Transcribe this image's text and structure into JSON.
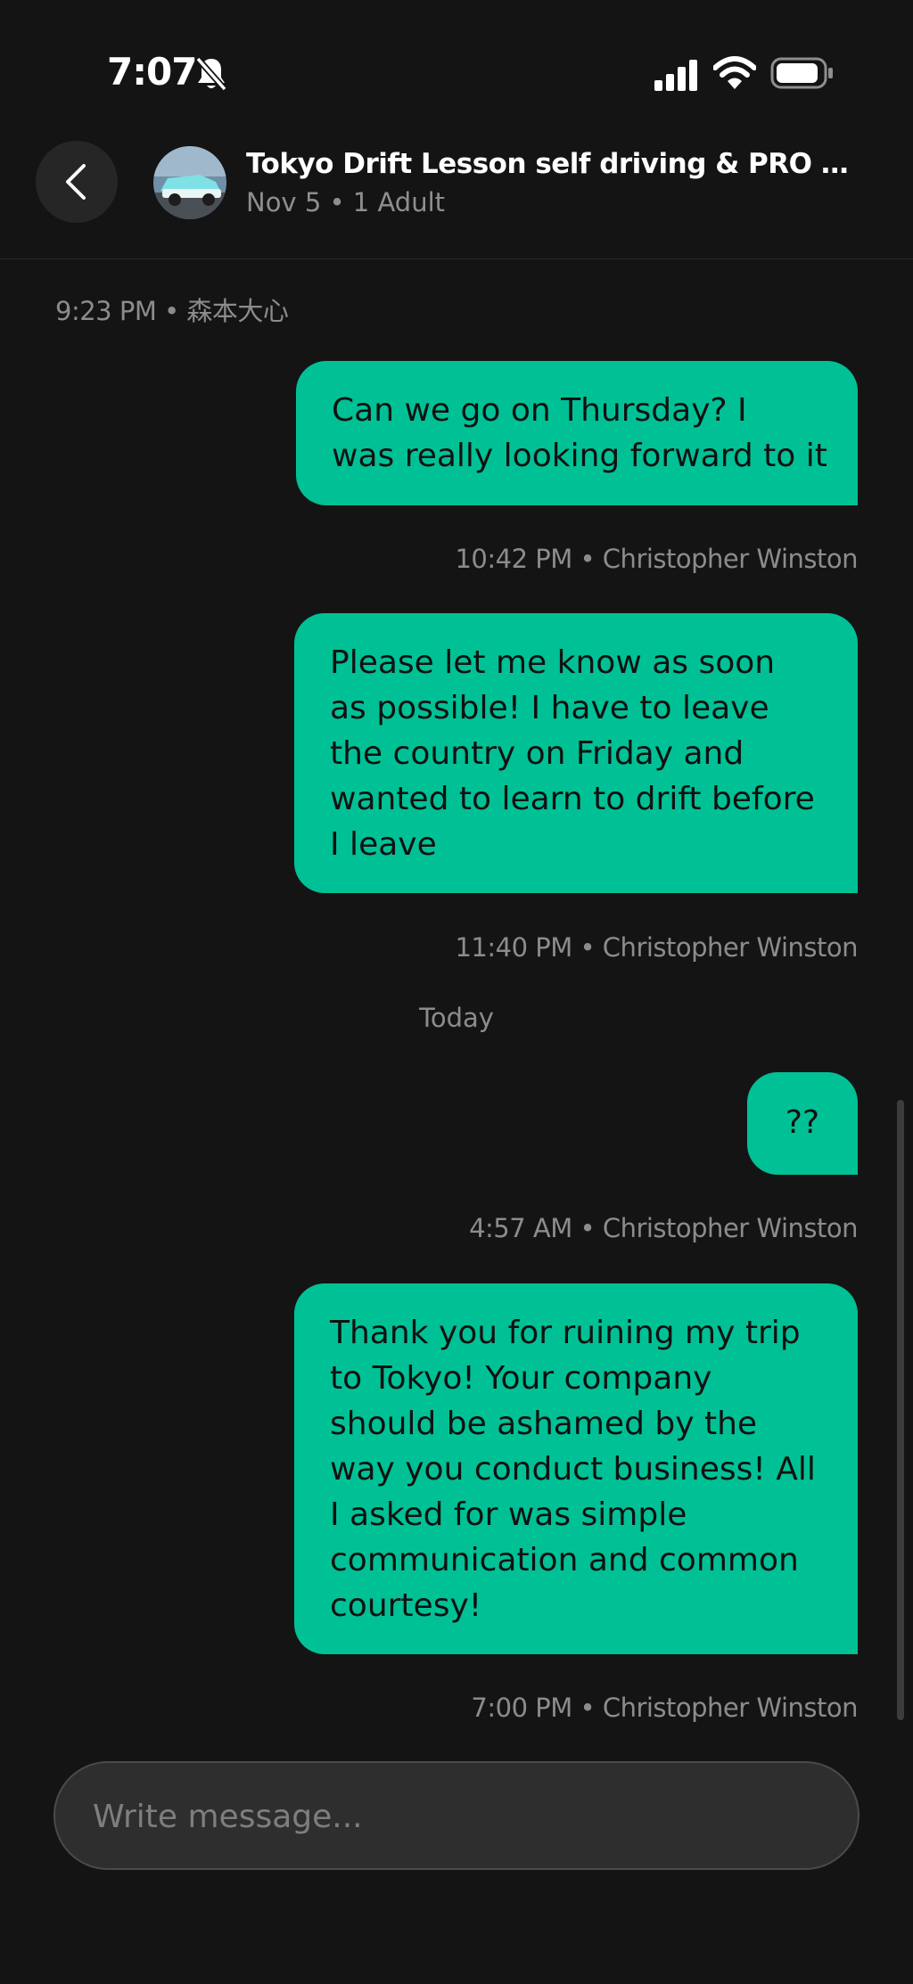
{
  "status_bar": {
    "time": "7:07"
  },
  "header": {
    "title": "Tokyo Drift Lesson self driving & PRO expe...",
    "subtitle": "Nov 5 • 1 Adult"
  },
  "messages": {
    "top_meta": "9:23 PM • 森本大心",
    "m1": {
      "text": "Can we go on Thursday? I\nwas really looking forward to it",
      "meta": "10:42 PM • Christopher Winston"
    },
    "m2": {
      "text": "Please let me know as soon\nas possible! I have to leave\nthe country on Friday and\nwanted to learn to drift before\nI leave",
      "meta": "11:40 PM • Christopher Winston"
    },
    "divider": "Today",
    "m3": {
      "text": "??",
      "meta": "4:57 AM • Christopher Winston"
    },
    "m4": {
      "text": "Thank you for ruining my trip\nto Tokyo! Your company\nshould be ashamed by the\nway you conduct business! All\nI asked for was simple\ncommunication and common\ncourtesy!",
      "meta": "7:00 PM • Christopher Winston"
    }
  },
  "composer": {
    "placeholder": "Write message..."
  },
  "colors": {
    "background": "#141414",
    "bubble": "#00c195",
    "meta_text": "#8c8c8c"
  }
}
